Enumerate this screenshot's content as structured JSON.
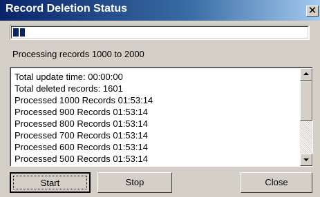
{
  "window": {
    "title": "Record Deletion Status",
    "close_glyph": "✕"
  },
  "progress": {
    "fraction": 0.04
  },
  "status": {
    "processing_text": "Processing records 1000 to 2000"
  },
  "log": {
    "lines": [
      "Total update time: 00:00:00",
      "Total deleted records: 1601",
      "Processed 1000 Records 01:53:14",
      "Processed 900 Records 01:53:14",
      "Processed 800 Records 01:53:14",
      "Processed 700 Records 01:53:14",
      "Processed 600 Records 01:53:14",
      "Processed 500 Records 01:53:14"
    ]
  },
  "buttons": {
    "start_label": "Start",
    "stop_label": "Stop",
    "close_label": "Close"
  },
  "colors": {
    "titlebar_start": "#0a246a",
    "progress_fill": "#0a246a",
    "face": "#d4d0c8"
  }
}
